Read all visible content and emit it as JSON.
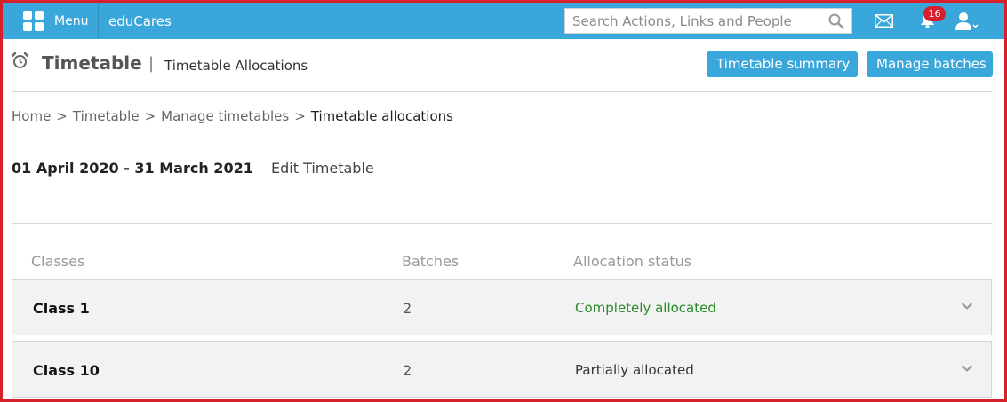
{
  "topbar": {
    "menu_label": "Menu",
    "brand": "eduCares",
    "search_placeholder": "Search Actions, Links and People",
    "notification_count": "16",
    "colors": {
      "bar": "#3aa7db",
      "badge": "#d8202c"
    }
  },
  "header": {
    "title": "Timetable",
    "separator": "|",
    "subtitle": "Timetable Allocations",
    "buttons": {
      "summary": "Timetable summary",
      "batches": "Manage batches"
    }
  },
  "breadcrumb": {
    "items": [
      "Home",
      "Timetable",
      "Manage timetables"
    ],
    "separator": ">",
    "current": "Timetable allocations"
  },
  "period": {
    "range": "01 April 2020 - 31 March 2021",
    "edit_label": "Edit Timetable"
  },
  "table": {
    "columns": [
      "Classes",
      "Batches",
      "Allocation status"
    ],
    "rows": [
      {
        "class": "Class 1",
        "batches": "2",
        "status": "Completely allocated",
        "status_color": "#2a8a2a"
      },
      {
        "class": "Class 10",
        "batches": "2",
        "status": "Partially allocated",
        "status_color": "#333333"
      }
    ]
  },
  "icons": {
    "menu": "grid-icon",
    "search": "search-icon",
    "mail": "mail-icon",
    "notifications": "bell-icon",
    "user": "user-icon",
    "page": "alarm-clock-icon",
    "row_expand": "chevron-down-icon"
  }
}
